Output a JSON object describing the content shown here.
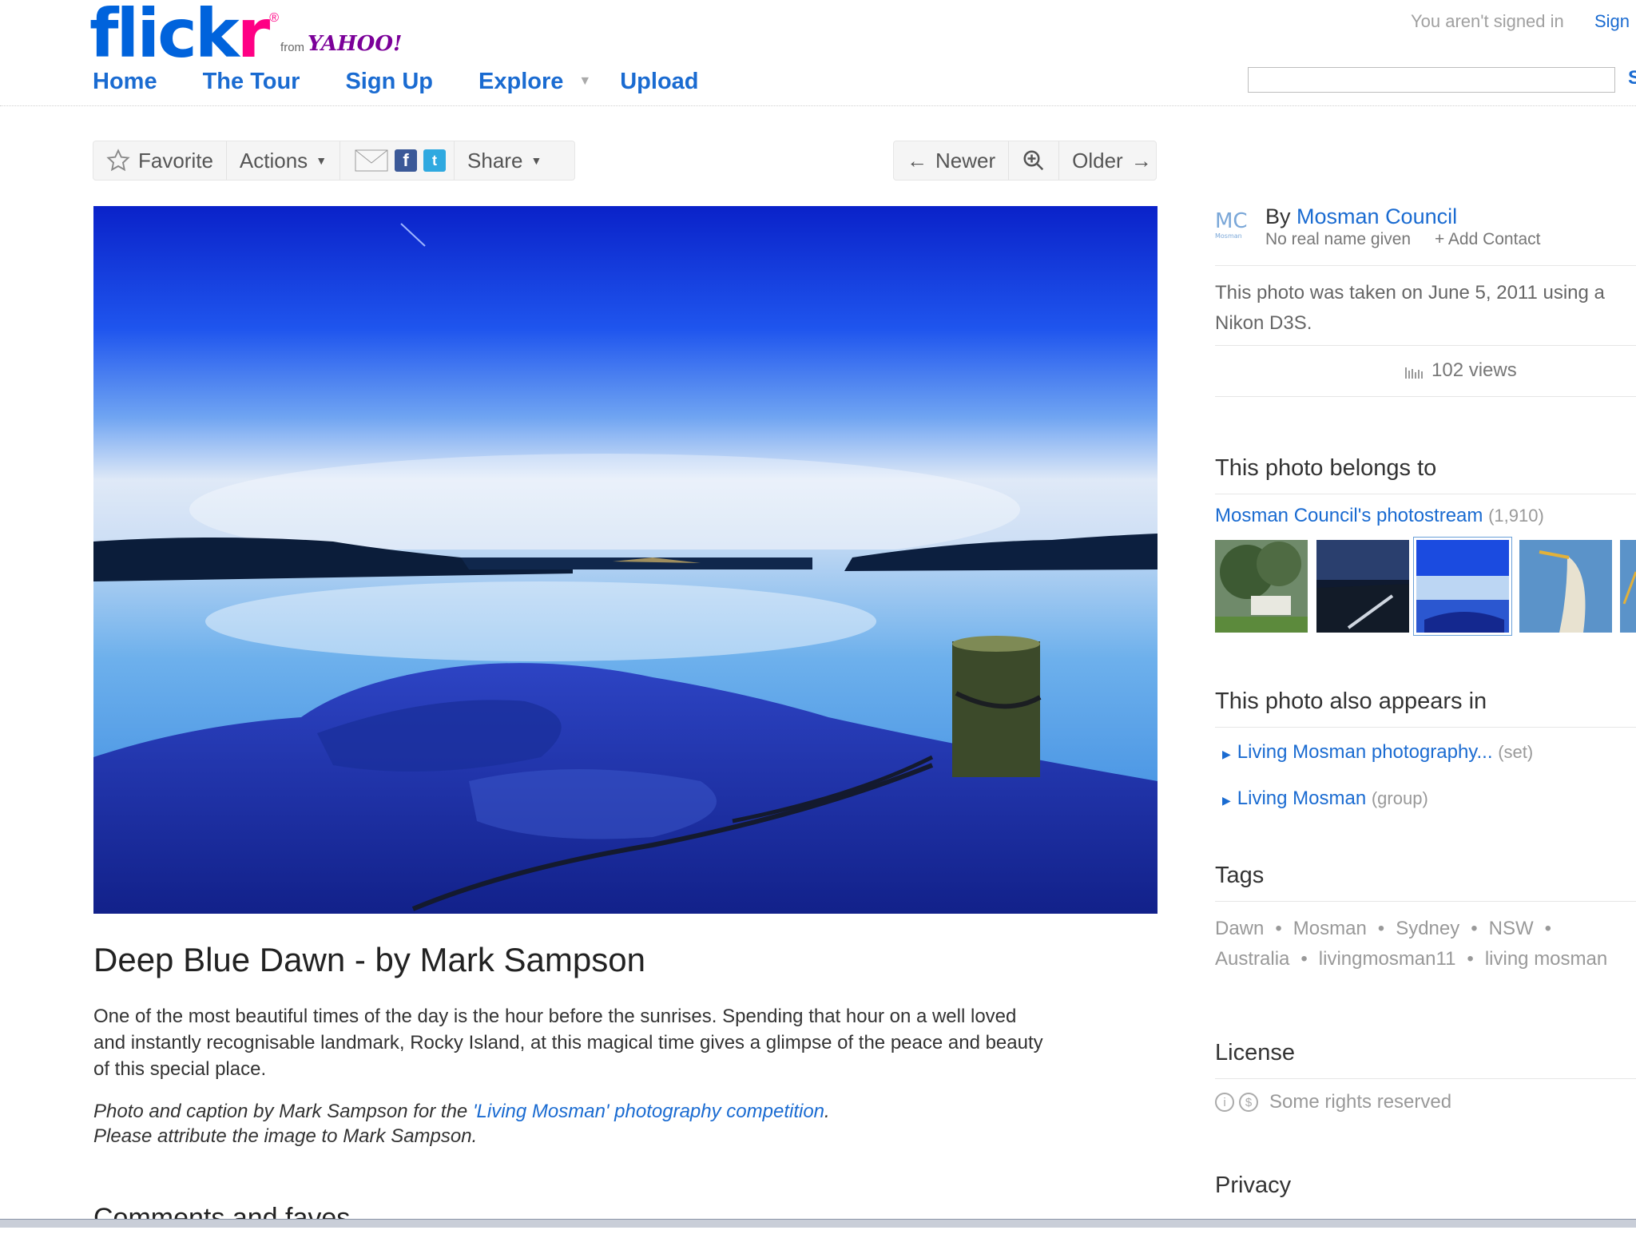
{
  "brand": {
    "logo_main": "flickr",
    "logo_from": "from",
    "logo_yahoo": "YAHOO!"
  },
  "header": {
    "nav": [
      "Home",
      "The Tour",
      "Sign Up",
      "Explore",
      "Upload"
    ],
    "signin_text": "You aren't signed in",
    "signin_link": "Sign In",
    "search_button": "S",
    "search_value": ""
  },
  "toolbar": {
    "favorite": "Favorite",
    "actions": "Actions",
    "share": "Share",
    "newer": "Newer",
    "older": "Older"
  },
  "photo": {
    "title": "Deep Blue Dawn - by Mark Sampson",
    "description": "One of the most beautiful times of the day is the hour before the sunrises. Spending that hour on a well loved and instantly recognisable landmark, Rocky Island, at this magical time gives a glimpse of the peace and beauty of this special place.",
    "credit_prefix": "Photo and caption by Mark Sampson for the ",
    "credit_link": "'Living Mosman' photography competition",
    "credit_suffix": ".",
    "attribution": "Please attribute the image to Mark Sampson.",
    "comments_heading": "Comments and faves"
  },
  "owner": {
    "avatar_text": "MC",
    "avatar_sub": "Mosman",
    "by_label": "By",
    "name": "Mosman Council",
    "real_name": "No real name given",
    "add_contact": "+ Add Contact"
  },
  "meta": {
    "taken": "This photo was taken on June 5, 2011 using a Nikon D3S.",
    "views": "102 views"
  },
  "belongs": {
    "heading": "This photo belongs to",
    "stream_name": "Mosman Council's photostream",
    "stream_count": "(1,910)"
  },
  "appears": {
    "heading": "This photo also appears in",
    "items": [
      {
        "label": "Living Mosman photography...",
        "kind": "(set)"
      },
      {
        "label": "Living Mosman",
        "kind": "(group)"
      }
    ]
  },
  "tags": {
    "heading": "Tags",
    "items": [
      "Dawn",
      "Mosman",
      "Sydney",
      "NSW",
      "Australia",
      "livingmosman11",
      "living mosman"
    ]
  },
  "license": {
    "heading": "License",
    "text": "Some rights reserved"
  },
  "privacy": {
    "heading": "Privacy"
  },
  "colors": {
    "link": "#1a6bd1",
    "flickr_blue": "#0063dc",
    "flickr_pink": "#ff0084"
  },
  "icons": [
    "star-icon",
    "caret-down-icon",
    "mail-icon",
    "facebook-icon",
    "twitter-icon",
    "arrow-left-icon",
    "zoom-icon",
    "arrow-right-icon",
    "views-bars-icon",
    "cc-attribution-icon",
    "cc-nc-icon"
  ]
}
